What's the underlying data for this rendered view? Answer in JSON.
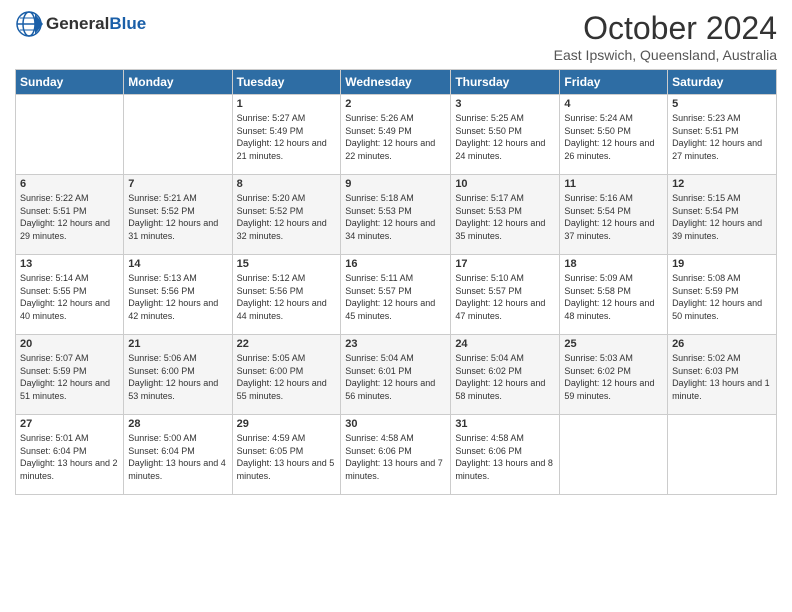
{
  "header": {
    "logo_general": "General",
    "logo_blue": "Blue",
    "month_title": "October 2024",
    "location": "East Ipswich, Queensland, Australia"
  },
  "weekdays": [
    "Sunday",
    "Monday",
    "Tuesday",
    "Wednesday",
    "Thursday",
    "Friday",
    "Saturday"
  ],
  "weeks": [
    [
      {
        "day": "",
        "info": ""
      },
      {
        "day": "",
        "info": ""
      },
      {
        "day": "1",
        "info": "Sunrise: 5:27 AM\nSunset: 5:49 PM\nDaylight: 12 hours and 21 minutes."
      },
      {
        "day": "2",
        "info": "Sunrise: 5:26 AM\nSunset: 5:49 PM\nDaylight: 12 hours and 22 minutes."
      },
      {
        "day": "3",
        "info": "Sunrise: 5:25 AM\nSunset: 5:50 PM\nDaylight: 12 hours and 24 minutes."
      },
      {
        "day": "4",
        "info": "Sunrise: 5:24 AM\nSunset: 5:50 PM\nDaylight: 12 hours and 26 minutes."
      },
      {
        "day": "5",
        "info": "Sunrise: 5:23 AM\nSunset: 5:51 PM\nDaylight: 12 hours and 27 minutes."
      }
    ],
    [
      {
        "day": "6",
        "info": "Sunrise: 5:22 AM\nSunset: 5:51 PM\nDaylight: 12 hours and 29 minutes."
      },
      {
        "day": "7",
        "info": "Sunrise: 5:21 AM\nSunset: 5:52 PM\nDaylight: 12 hours and 31 minutes."
      },
      {
        "day": "8",
        "info": "Sunrise: 5:20 AM\nSunset: 5:52 PM\nDaylight: 12 hours and 32 minutes."
      },
      {
        "day": "9",
        "info": "Sunrise: 5:18 AM\nSunset: 5:53 PM\nDaylight: 12 hours and 34 minutes."
      },
      {
        "day": "10",
        "info": "Sunrise: 5:17 AM\nSunset: 5:53 PM\nDaylight: 12 hours and 35 minutes."
      },
      {
        "day": "11",
        "info": "Sunrise: 5:16 AM\nSunset: 5:54 PM\nDaylight: 12 hours and 37 minutes."
      },
      {
        "day": "12",
        "info": "Sunrise: 5:15 AM\nSunset: 5:54 PM\nDaylight: 12 hours and 39 minutes."
      }
    ],
    [
      {
        "day": "13",
        "info": "Sunrise: 5:14 AM\nSunset: 5:55 PM\nDaylight: 12 hours and 40 minutes."
      },
      {
        "day": "14",
        "info": "Sunrise: 5:13 AM\nSunset: 5:56 PM\nDaylight: 12 hours and 42 minutes."
      },
      {
        "day": "15",
        "info": "Sunrise: 5:12 AM\nSunset: 5:56 PM\nDaylight: 12 hours and 44 minutes."
      },
      {
        "day": "16",
        "info": "Sunrise: 5:11 AM\nSunset: 5:57 PM\nDaylight: 12 hours and 45 minutes."
      },
      {
        "day": "17",
        "info": "Sunrise: 5:10 AM\nSunset: 5:57 PM\nDaylight: 12 hours and 47 minutes."
      },
      {
        "day": "18",
        "info": "Sunrise: 5:09 AM\nSunset: 5:58 PM\nDaylight: 12 hours and 48 minutes."
      },
      {
        "day": "19",
        "info": "Sunrise: 5:08 AM\nSunset: 5:59 PM\nDaylight: 12 hours and 50 minutes."
      }
    ],
    [
      {
        "day": "20",
        "info": "Sunrise: 5:07 AM\nSunset: 5:59 PM\nDaylight: 12 hours and 51 minutes."
      },
      {
        "day": "21",
        "info": "Sunrise: 5:06 AM\nSunset: 6:00 PM\nDaylight: 12 hours and 53 minutes."
      },
      {
        "day": "22",
        "info": "Sunrise: 5:05 AM\nSunset: 6:00 PM\nDaylight: 12 hours and 55 minutes."
      },
      {
        "day": "23",
        "info": "Sunrise: 5:04 AM\nSunset: 6:01 PM\nDaylight: 12 hours and 56 minutes."
      },
      {
        "day": "24",
        "info": "Sunrise: 5:04 AM\nSunset: 6:02 PM\nDaylight: 12 hours and 58 minutes."
      },
      {
        "day": "25",
        "info": "Sunrise: 5:03 AM\nSunset: 6:02 PM\nDaylight: 12 hours and 59 minutes."
      },
      {
        "day": "26",
        "info": "Sunrise: 5:02 AM\nSunset: 6:03 PM\nDaylight: 13 hours and 1 minute."
      }
    ],
    [
      {
        "day": "27",
        "info": "Sunrise: 5:01 AM\nSunset: 6:04 PM\nDaylight: 13 hours and 2 minutes."
      },
      {
        "day": "28",
        "info": "Sunrise: 5:00 AM\nSunset: 6:04 PM\nDaylight: 13 hours and 4 minutes."
      },
      {
        "day": "29",
        "info": "Sunrise: 4:59 AM\nSunset: 6:05 PM\nDaylight: 13 hours and 5 minutes."
      },
      {
        "day": "30",
        "info": "Sunrise: 4:58 AM\nSunset: 6:06 PM\nDaylight: 13 hours and 7 minutes."
      },
      {
        "day": "31",
        "info": "Sunrise: 4:58 AM\nSunset: 6:06 PM\nDaylight: 13 hours and 8 minutes."
      },
      {
        "day": "",
        "info": ""
      },
      {
        "day": "",
        "info": ""
      }
    ]
  ]
}
